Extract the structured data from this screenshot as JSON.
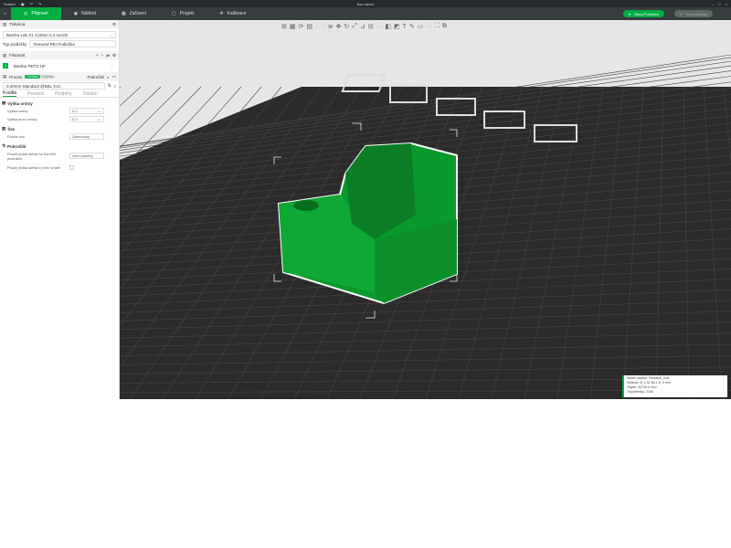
{
  "window": {
    "title": "Bez názvu",
    "menu_label": "Soubor"
  },
  "tabs": [
    {
      "label": "Připravit"
    },
    {
      "label": "Náhled"
    },
    {
      "label": "Zařízení"
    },
    {
      "label": "Projekt"
    },
    {
      "label": "Kalibrace"
    }
  ],
  "actions": {
    "slice": "Slicuj Podložku",
    "print": "Tisk podložky"
  },
  "printer": {
    "section": "Tiskárna",
    "name": "Bambu Lab X1 Carbon 0.4 nozzle",
    "plate_label": "Typ podložky",
    "plate_value": "Textured PEI Podložka"
  },
  "filament": {
    "section": "Filament",
    "item_index": "1",
    "item": "Bambu PETG HF"
  },
  "process": {
    "section": "Proces",
    "toggle_on": "Globální",
    "toggle_off": "Objekty",
    "advanced": "Pokročilé",
    "preset": "0.20mm Standard @BBL X1C",
    "tabs": [
      "Kvalita",
      "Pevnost",
      "Podpěry",
      "Ostatní"
    ],
    "groups": [
      {
        "title": "Výška vrstvy",
        "options": [
          {
            "label": "Výška vrstvy",
            "value": "0.2",
            "unit": "mm"
          },
          {
            "label": "Výška první vrstvy",
            "value": "0.2",
            "unit": "mm"
          }
        ]
      },
      {
        "title": "Šev",
        "options": [
          {
            "label": "Pozice švu",
            "value": "Zarovnaný"
          }
        ]
      },
      {
        "title": "Pokročilé",
        "options": [
          {
            "label": "Pouze jedna stěna na horních plochách",
            "value": "Horní plochy"
          },
          {
            "label": "Pouze jedna stěna v první vrstvě",
            "value": ""
          }
        ]
      }
    ]
  },
  "object_info": {
    "name": "Název objektu: Redukce_4.stl",
    "size": "Velikost: 47 x 31.36 x 47.5 mm",
    "volume": "Objem: 32726.9 mm³",
    "triangles": "Trojúhelníky: 2196"
  },
  "colors": {
    "accent": "#00ae42",
    "object": "#0a9a2c",
    "bed": "#2b2b2b"
  }
}
